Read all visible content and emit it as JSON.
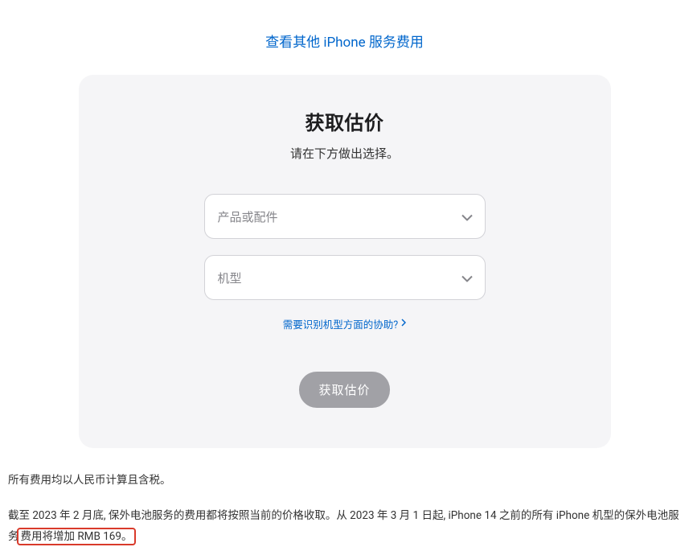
{
  "topLink": {
    "label": "查看其他 iPhone 服务费用"
  },
  "card": {
    "title": "获取估价",
    "subtitle": "请在下方做出选择。",
    "select1": {
      "placeholder": "产品或配件"
    },
    "select2": {
      "placeholder": "机型"
    },
    "helpLink": {
      "label": "需要识别机型方面的协助?"
    },
    "button": {
      "label": "获取估价"
    }
  },
  "footer": {
    "line1": "所有费用均以人民币计算且含税。",
    "line2_part1": "截至 2023 年 2 月底, 保外电池服务的费用都将按照当前的价格收取。从 2023 年 3 月 1 日起, iPhone 14 之前的所有 iPhone 机型的保外电池服务",
    "line2_highlight": "费用将增加 RMB 169。"
  }
}
